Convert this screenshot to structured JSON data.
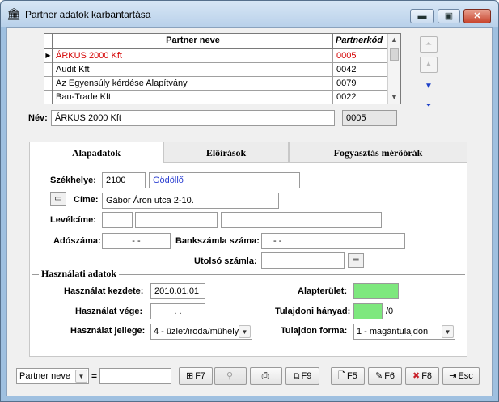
{
  "window": {
    "title": "Partner adatok karbantartása",
    "controls": {
      "minimize": "▬",
      "maximize": "▣",
      "close": "✕"
    }
  },
  "grid": {
    "columns": {
      "name": "Partner neve",
      "code": "Partnerkód"
    },
    "rows": [
      {
        "name": "ÁRKUS 2000 Kft",
        "code": "0005",
        "selected": true,
        "indicator": "▶"
      },
      {
        "name": "Audit Kft",
        "code": "0042"
      },
      {
        "name": "Az Egyensúly kérdése Alapítvány",
        "code": "0079"
      },
      {
        "name": "Bau-Trade Kft",
        "code": "0022"
      }
    ],
    "scroll": {
      "up": "▲",
      "down": "▼"
    }
  },
  "nav": {
    "first": "⏶",
    "prev": "▲",
    "next": "▼",
    "last": "⏷"
  },
  "nev": {
    "label": "Név:",
    "value": "ÁRKUS 2000 Kft",
    "code": "0005"
  },
  "tabs": [
    {
      "label": "Alapadatok",
      "active": true
    },
    {
      "label": "Előírások"
    },
    {
      "label": "Fogyasztás mérőórák"
    }
  ],
  "alapadatok": {
    "szekhely": {
      "label": "Székhelye:",
      "zip": "2100",
      "city": "Gödöllő"
    },
    "cime": {
      "label": "Címe:",
      "value": "Gábor Áron utca 2-10.",
      "icon": "▭"
    },
    "levelcime": {
      "label": "Levélcíme:",
      "zip": "",
      "city": "",
      "street": ""
    },
    "adoszama": {
      "label": "Adószáma:",
      "value": "- -"
    },
    "bankszamla": {
      "label": "Bankszámla száma:",
      "value": "-        -"
    },
    "utolso": {
      "label": "Utolsó számla:",
      "value": "",
      "button": "═"
    }
  },
  "hasznalati": {
    "title": "Használati adatok",
    "kezdete": {
      "label": "Használat kezdete:",
      "value": "2010.01.01"
    },
    "vege": {
      "label": "Használat vége:",
      "value": ". ."
    },
    "jellege": {
      "label": "Használat jellege:",
      "value": "4 - üzlet/iroda/műhely"
    },
    "alapterulet": {
      "label": "Alapterület:",
      "value": ""
    },
    "tulajdoni": {
      "label": "Tulajdoni hányad:",
      "value": "",
      "suffix": "/0"
    },
    "forma": {
      "label": "Tulajdon forma:",
      "value": "1 - magántulajdon"
    },
    "combo_arrow": "▼"
  },
  "toolbar": {
    "search_field": "Partner neve",
    "equals": "=",
    "search_value": "",
    "buttons": [
      {
        "icon": "⊞",
        "label": "F7"
      },
      {
        "icon": "⚲",
        "label": ""
      },
      {
        "icon": "⎙",
        "label": ""
      },
      {
        "icon": "⧉",
        "label": "F9"
      },
      {
        "icon": "🗋",
        "label": "F5"
      },
      {
        "icon": "✎",
        "label": "F6"
      },
      {
        "icon": "✖",
        "label": "F8"
      },
      {
        "icon": "⇥",
        "label": "Esc"
      }
    ]
  }
}
